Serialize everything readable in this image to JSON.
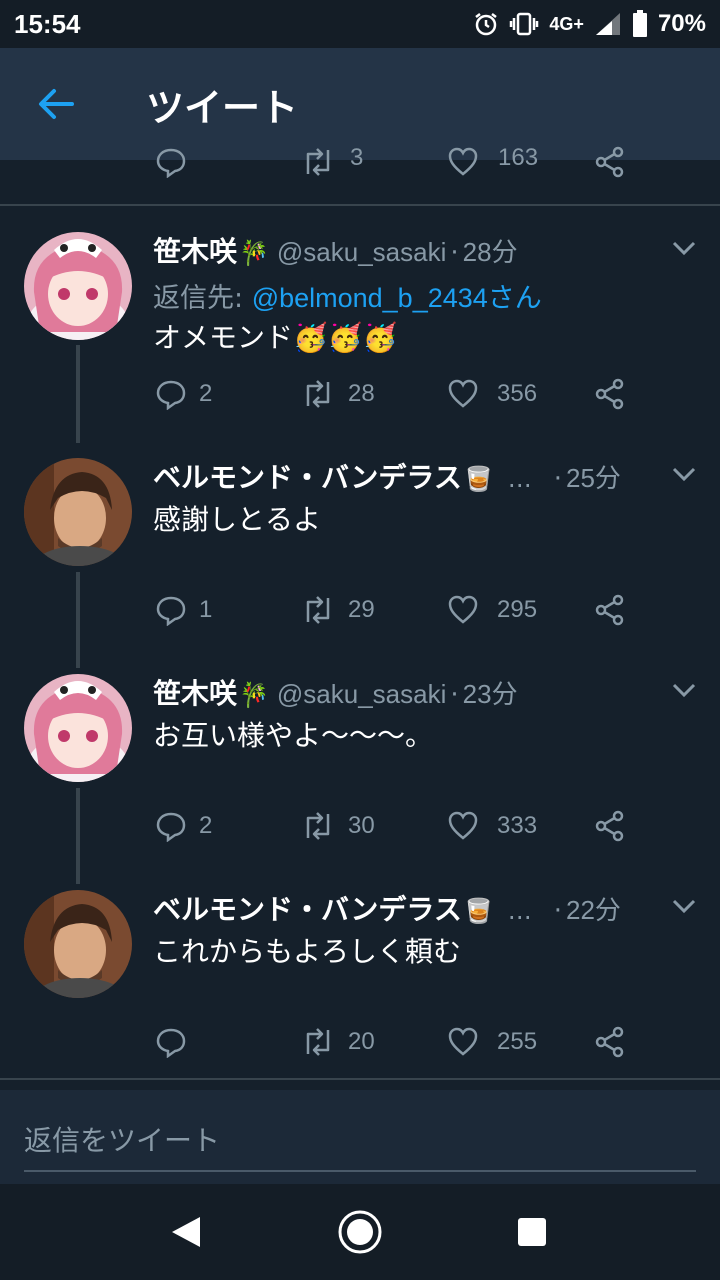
{
  "status_bar": {
    "time": "15:54",
    "network": "4G+",
    "battery": "70%"
  },
  "header": {
    "title": "ツイート"
  },
  "previous_tweet_actions": {
    "retweets": "3",
    "likes": "163"
  },
  "tweets": [
    {
      "name": "笹木咲",
      "name_emoji": "🎋",
      "handle": "@saku_sasaki",
      "time": "28分",
      "reply_prefix": "返信先: ",
      "reply_to": "@belmond_b_2434さん",
      "text": "オメモンド🥳🥳🥳",
      "replies": "2",
      "retweets": "28",
      "likes": "356"
    },
    {
      "name": "ベルモンド・バンデラス",
      "name_emoji": "🥃",
      "ellipsis": "…",
      "time": "25分",
      "text": "感謝しとるよ",
      "replies": "1",
      "retweets": "29",
      "likes": "295"
    },
    {
      "name": "笹木咲",
      "name_emoji": "🎋",
      "handle": "@saku_sasaki",
      "time": "23分",
      "text": "お互い様やよ〜〜〜。",
      "replies": "2",
      "retweets": "30",
      "likes": "333"
    },
    {
      "name": "ベルモンド・バンデラス",
      "name_emoji": "🥃",
      "ellipsis": "…",
      "time": "22分",
      "text": "これからもよろしく頼む",
      "replies": "",
      "retweets": "20",
      "likes": "255"
    }
  ],
  "reply_box": {
    "placeholder": "返信をツイート"
  },
  "colors": {
    "background": "#15202b",
    "header": "#243447",
    "accent": "#1da1f2",
    "muted": "#8899a6"
  },
  "icons": [
    "back-arrow-icon",
    "reply-icon",
    "retweet-icon",
    "like-icon",
    "share-icon",
    "chevron-down-icon",
    "nav-back-icon",
    "nav-home-icon",
    "nav-recents-icon"
  ]
}
